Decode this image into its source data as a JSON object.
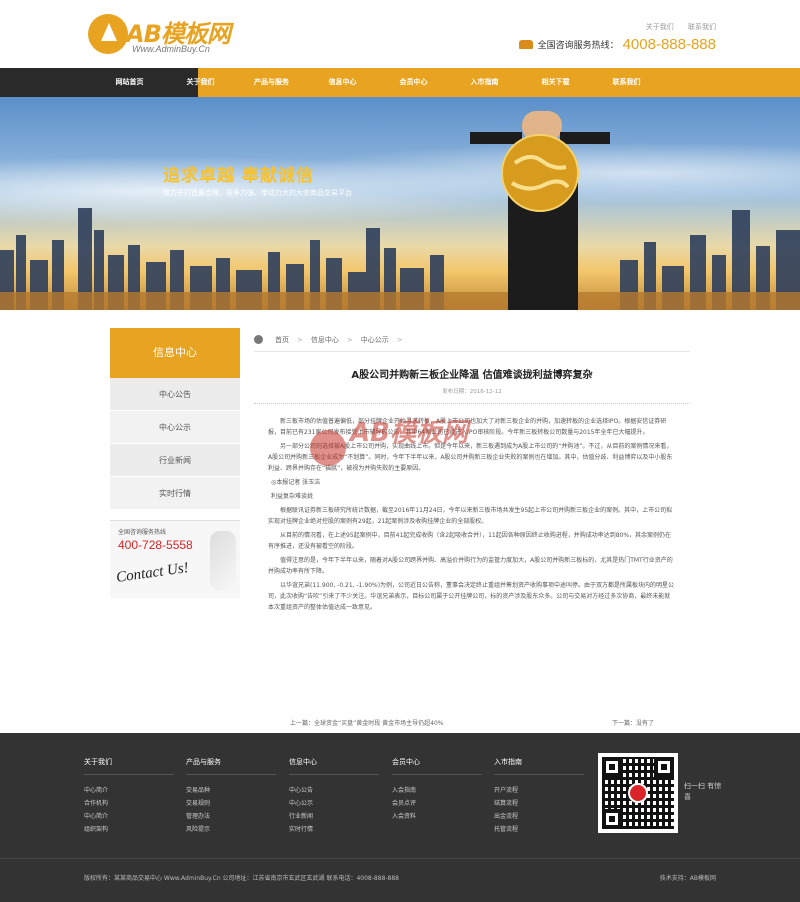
{
  "header": {
    "logo_name": "AB模板网",
    "logo_url": "Www.AdminBuy.Cn",
    "top_links": [
      "关于我们",
      "联系我们"
    ],
    "hotline_label": "全国咨询服务热线：",
    "hotline_number": "4008-888-888"
  },
  "nav": {
    "items": [
      "网站首页",
      "关于我们",
      "产品与服务",
      "信息中心",
      "会员中心",
      "入市指南",
      "相关下载",
      "联系我们"
    ]
  },
  "banner": {
    "slogan": "追求卓越  奉献诚信",
    "sub": "致力于打造最合理、竞争力强、带动力大的大宗商品交易平台"
  },
  "sidebar": {
    "title": "信息中心",
    "items": [
      "中心公告",
      "中心公示",
      "行业新闻",
      "实时行情"
    ],
    "contact_label": "全国咨询服务热线",
    "contact_number": "400-728-5558",
    "contact_script": "Contact Us!"
  },
  "breadcrumb": [
    "首页",
    "信息中心",
    "中心公示"
  ],
  "article": {
    "title": "A股公司并购新三板企业降温 估值难谈拢利益博弈复杂",
    "date": "发布日期：2016-12-12",
    "paragraphs": [
      "新三板市场的估值普遍偏低，部分挂牌企业开始寻求转板，A股上市公司也加大了对新三板企业的并购，加速转板的企业选择IPO。根据安信证券研报，目前已有231家公司发布接受上市辅导的公告，其中64家公司已经进入IPO审核阶段。今年新三板转板公司数量与2015年全年已大幅提升。",
      "另一部分公司则选择被A股上市公司并购，实现曲线上市。但是今年以来，新三板遇到成为A股上市公司的“并购池”。不过，从目前的案例情况来看，A股公司并购新三板企业成为“不划算”。同时，今年下半年以来，A股公司并购新三板企业失败的案例也在增加。其中，估值分歧、利益博弈以及中小股东利益、跨界并购存在“猫腻”，被视为并购失败的主要原因。",
      "◎本报记者 张玉洁",
      "利益复杂难谈拢",
      "根据联讯证券新三板研究所统计数据，截至2016年11月24日，今年以来新三板市场共发生95起上市公司并购新三板企业的案例。其中，上市公司拟实现对挂牌企业绝对控股的案例有29起，21起案例涉及收购挂牌企业的全部股权。",
      "从目前的情况看，在上述95起案例中，目前41起完成收购（含2起吸收合并），11起因各种原因终止收购进程，并购成功率达到80%，其余案例仍在有序推进，还没有被看空的阶段。",
      "值得注意的是，今年下半年以来，随着对A股公司跨界并购、高溢价并购行为的监管力度加大，A股公司并购新三板标的，尤其是热门TMT行业资产的并购成功率有所下降。",
      "以华谊兄弟(11.900, -0.21, -1.90%)为例，公司近日公告称，董事会决定终止重组并筹划资产收购事项中途叫停。由于双方都是所属板块内的明星公司，此次收购“告吹”引来了不少关注。华谊兄弟表示，目标公司属于公开挂牌公司，标的资产涉及股东众多。公司与交易对方经过多次协商，最终未能就本次重组资产的整体估值达成一致意见。"
    ],
    "prev": "上一篇：全球资金“买盘”黄金时段 黄金市场主导仍超40%",
    "next": "下一篇：没有了"
  },
  "watermark": "AB模板网",
  "footer": {
    "columns": [
      {
        "title": "关于我们",
        "links": [
          "中心简介",
          "合作机构",
          "中心简介",
          "组织架构"
        ]
      },
      {
        "title": "产品与服务",
        "links": [
          "交易品种",
          "交易规则",
          "管理办法",
          "风险提示"
        ]
      },
      {
        "title": "信息中心",
        "links": [
          "中心公告",
          "中心公示",
          "行业新闻",
          "实时行情"
        ]
      },
      {
        "title": "会员中心",
        "links": [
          "入会指南",
          "会员点评",
          "入会资料"
        ]
      },
      {
        "title": "入市指南",
        "links": [
          "开户流程",
          "结算流程",
          "出金流程",
          "托管流程"
        ]
      }
    ],
    "qr_label": "扫一扫 有惊喜",
    "copyright": "版权所有：某某商品交易中心 Www.AdminBuy.Cn   公司地址：江苏省南京市玄武区玄武湖   联系电话：4008-888-888",
    "support": "技术支持：AB模板网"
  }
}
